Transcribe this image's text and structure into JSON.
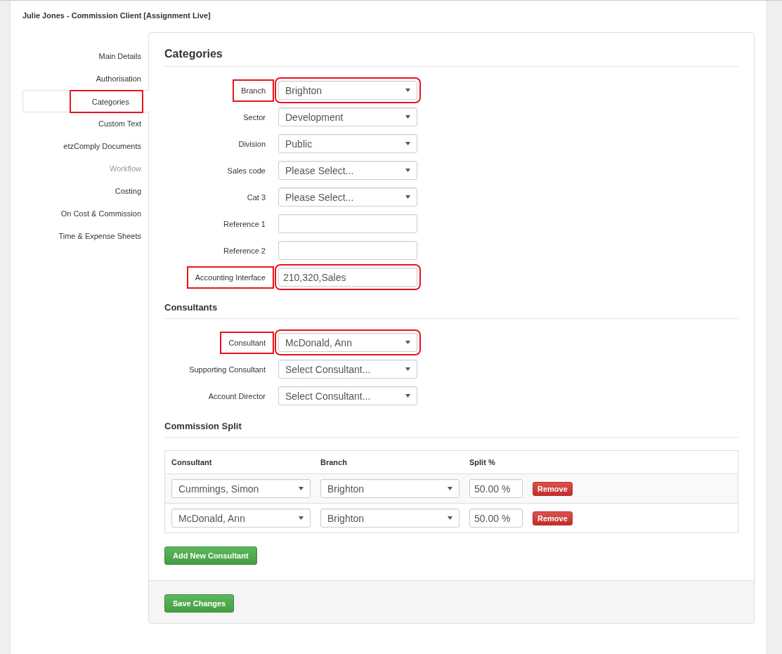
{
  "header": {
    "title": "Julie Jones - Commission Client [Assignment Live]"
  },
  "sidebar": {
    "items": [
      {
        "label": "Main Details",
        "selected": false,
        "disabled": false,
        "highlighted": false
      },
      {
        "label": "Authorisation",
        "selected": false,
        "disabled": false,
        "highlighted": false
      },
      {
        "label": "Categories",
        "selected": true,
        "disabled": false,
        "highlighted": true
      },
      {
        "label": "Custom Text",
        "selected": false,
        "disabled": false,
        "highlighted": false
      },
      {
        "label": "etzComply Documents",
        "selected": false,
        "disabled": false,
        "highlighted": false
      },
      {
        "label": "Workflow",
        "selected": false,
        "disabled": true,
        "highlighted": false
      },
      {
        "label": "Costing",
        "selected": false,
        "disabled": false,
        "highlighted": false
      },
      {
        "label": "On Cost & Commission",
        "selected": false,
        "disabled": false,
        "highlighted": false
      },
      {
        "label": "Time & Expense Sheets",
        "selected": false,
        "disabled": false,
        "highlighted": false
      }
    ]
  },
  "sections": [
    {
      "title": "Categories",
      "fields": [
        {
          "label": "Branch",
          "kind": "select",
          "value": "Brighton",
          "highlighted": true
        },
        {
          "label": "Sector",
          "kind": "select",
          "value": "Development",
          "highlighted": false
        },
        {
          "label": "Division",
          "kind": "select",
          "value": "Public",
          "highlighted": false
        },
        {
          "label": "Sales code",
          "kind": "select",
          "value": "Please Select...",
          "highlighted": false
        },
        {
          "label": "Cat 3",
          "kind": "select",
          "value": "Please Select...",
          "highlighted": false
        },
        {
          "label": "Reference 1",
          "kind": "text",
          "highlighted": false
        },
        {
          "label": "Reference 2",
          "kind": "text",
          "highlighted": false
        },
        {
          "label": "Accounting Interface",
          "kind": "text",
          "value": "210,320,Sales",
          "highlighted": true
        }
      ]
    },
    {
      "title": "Consultants",
      "fields": [
        {
          "label": "Consultant",
          "kind": "select",
          "value": "McDonald, Ann",
          "highlighted": true
        },
        {
          "label": "Supporting Consultant",
          "kind": "select",
          "value": "Select Consultant...",
          "highlighted": false
        },
        {
          "label": "Account Director",
          "kind": "select",
          "value": "Select Consultant...",
          "highlighted": false
        }
      ]
    }
  ],
  "commission_split": {
    "title": "Commission Split",
    "columns": [
      "Consultant",
      "Branch",
      "Split %"
    ],
    "rows": [
      {
        "consultant": "Cummings, Simon",
        "branch": "Brighton",
        "split": "50.00 %",
        "remove": "Remove"
      },
      {
        "consultant": "McDonald, Ann",
        "branch": "Brighton",
        "split": "50.00 %",
        "remove": "Remove"
      }
    ],
    "add_button": "Add New Consultant"
  },
  "footer": {
    "save_button": "Save Changes"
  }
}
